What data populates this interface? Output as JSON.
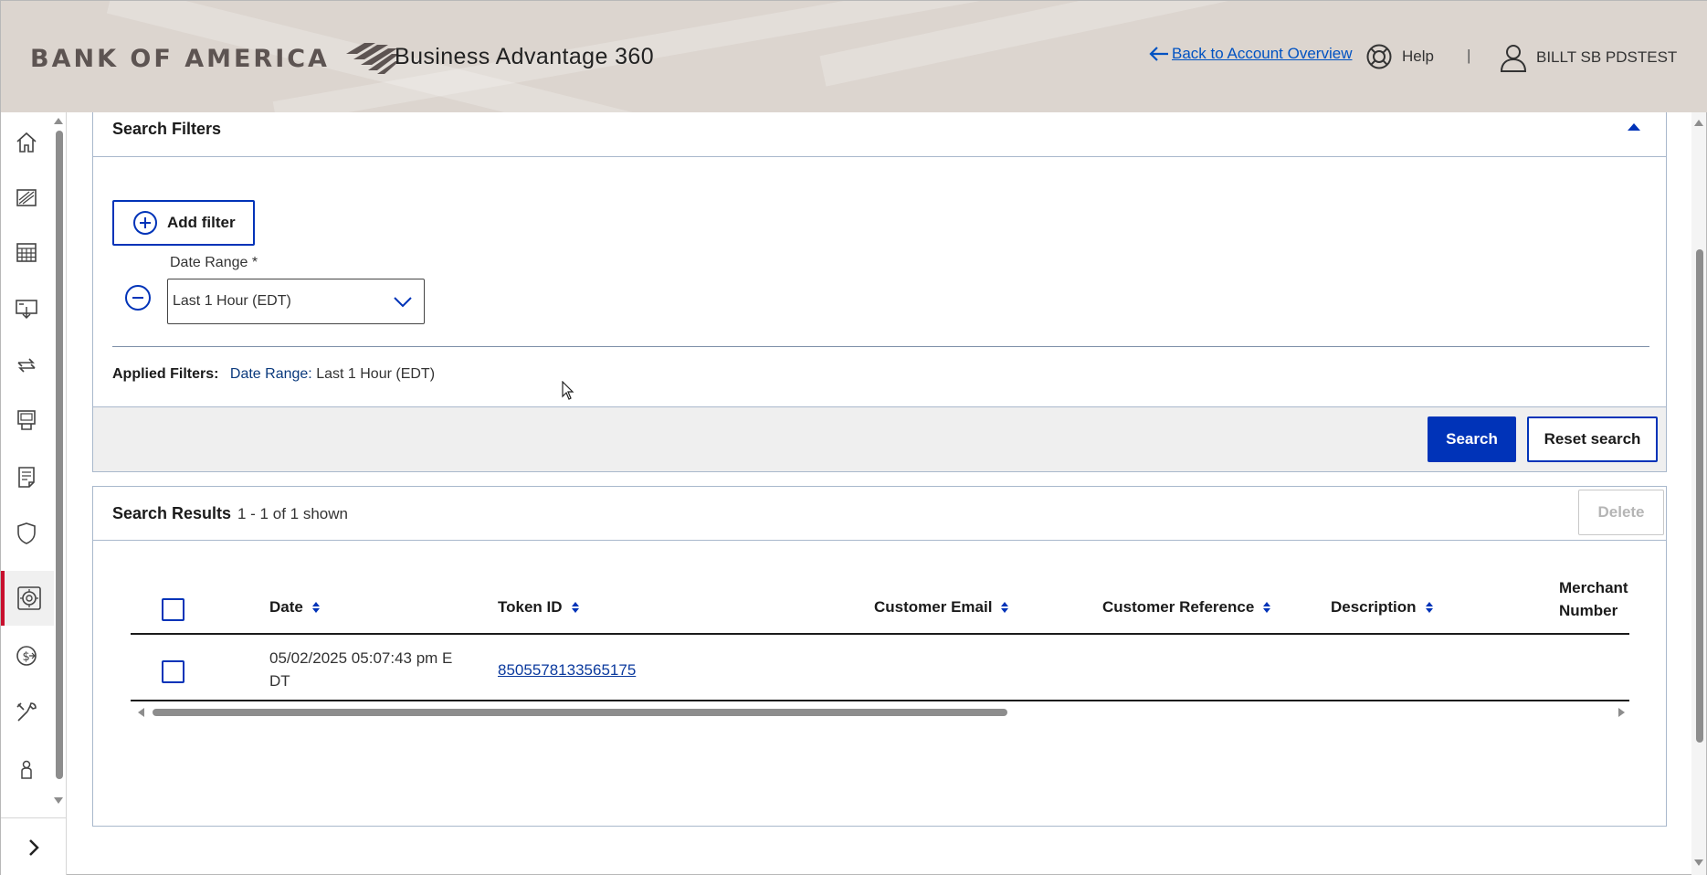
{
  "header": {
    "logo_text": "BANK OF AMERICA",
    "product_name": "Business Advantage 360",
    "back_link": "Back to Account Overview",
    "help": "Help",
    "separator": "|",
    "user_name": "BILLT SB PDSTEST"
  },
  "rail": {
    "items": [
      {
        "icon": "home-icon"
      },
      {
        "icon": "accounts-chart-icon"
      },
      {
        "icon": "calendar-icon"
      },
      {
        "icon": "deposit-icon"
      },
      {
        "icon": "transfers-icon"
      },
      {
        "icon": "terminal-icon"
      },
      {
        "icon": "reports-icon"
      },
      {
        "icon": "security-shield-icon"
      },
      {
        "icon": "merchant-services-icon",
        "active": true
      },
      {
        "icon": "payments-icon"
      },
      {
        "icon": "tools-icon"
      },
      {
        "icon": "user-icon"
      }
    ],
    "expand_icon": "chevron-right-icon",
    "active_color": "#c8102e"
  },
  "filters": {
    "title": "Search Filters",
    "add_filter_label": "Add filter",
    "date_range_label": "Date Range *",
    "date_range_value": "Last 1 Hour (EDT)",
    "applied_label": "Applied Filters:",
    "applied_filter_name": "Date Range:",
    "applied_filter_value": "Last 1 Hour (EDT)",
    "search_label": "Search",
    "reset_label": "Reset search"
  },
  "results": {
    "title": "Search Results",
    "count_text": "1 - 1 of 1 shown",
    "delete_label": "Delete",
    "columns": {
      "date": "Date",
      "token_id": "Token ID",
      "customer_email": "Customer Email",
      "customer_reference": "Customer Reference",
      "description": "Description",
      "merchant_number_1": "Merchant",
      "merchant_number_2": "Number"
    },
    "rows": [
      {
        "date_line1": "05/02/2025 05:07:43 pm E",
        "date_line2": "DT",
        "token_id": "8505578133565175",
        "customer_email": "",
        "customer_reference": "",
        "description": ""
      }
    ]
  },
  "colors": {
    "primary_blue": "#0033b8",
    "header_bg": "#dcd5cf",
    "link_blue": "#0052c2",
    "brand_red": "#c8102e"
  }
}
